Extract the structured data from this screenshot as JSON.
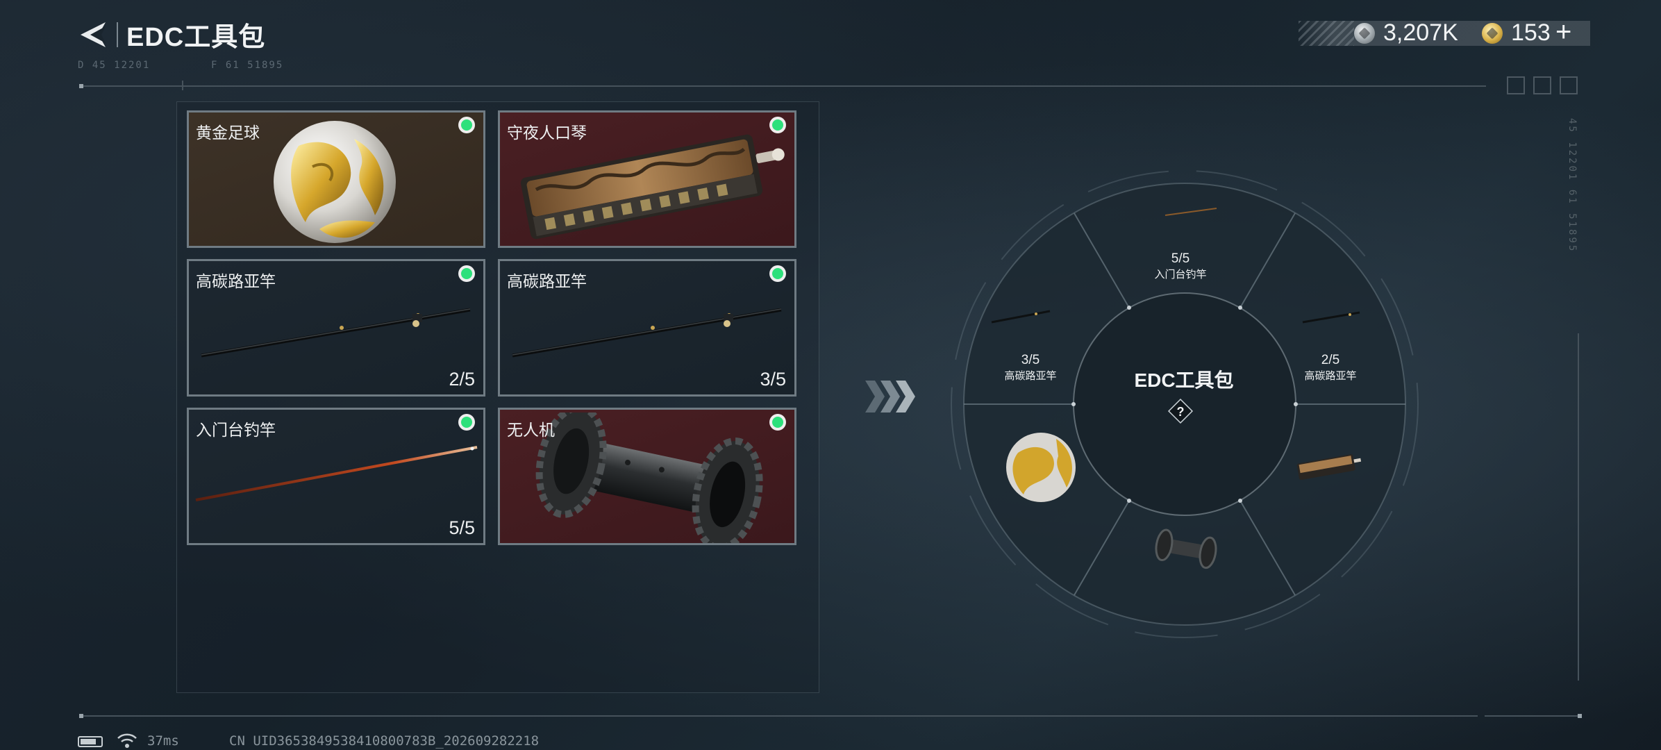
{
  "header": {
    "title": "EDC工具包",
    "code_left": "D 45  12201",
    "code_right": "F 61  51895"
  },
  "currency": {
    "silver_icon": "silver-coin-icon",
    "silver_value": "3,207K",
    "gold_icon": "gold-coin-icon",
    "gold_value": "153",
    "add_label": "+"
  },
  "side_code": "45 12201   61 51895",
  "inventory": {
    "items": [
      {
        "name": "黄金足球",
        "progress": "",
        "card_color": "#3a2f24",
        "status_color": "#2de07b"
      },
      {
        "name": "守夜人口琴",
        "progress": "",
        "card_color": "#451d21",
        "status_color": "#2de07b"
      },
      {
        "name": "高碳路亚竿",
        "progress": "2/5",
        "card_color": "#1b252d",
        "status_color": "#2de07b"
      },
      {
        "name": "高碳路亚竿",
        "progress": "3/5",
        "card_color": "#1b252d",
        "status_color": "#2de07b"
      },
      {
        "name": "入门台钓竿",
        "progress": "5/5",
        "card_color": "#1b252d",
        "status_color": "#2de07b"
      },
      {
        "name": "无人机",
        "progress": "",
        "card_color": "#451d21",
        "status_color": "#2de07b"
      }
    ]
  },
  "wheel": {
    "center_title": "EDC工具包",
    "center_icon": "?",
    "slots": [
      {
        "progress": "5/5",
        "name": "入门台钓竿"
      },
      {
        "progress": "2/5",
        "name": "高碳路亚竿"
      },
      {
        "progress": "3/5",
        "name": "高碳路亚竿"
      }
    ]
  },
  "footer": {
    "ping": "37ms",
    "uid": "CN UID3653849538410800783B_202609282218"
  },
  "colors": {
    "accent_green": "#2de07b",
    "card_border": "#6f7b83",
    "background": "#18232c"
  }
}
